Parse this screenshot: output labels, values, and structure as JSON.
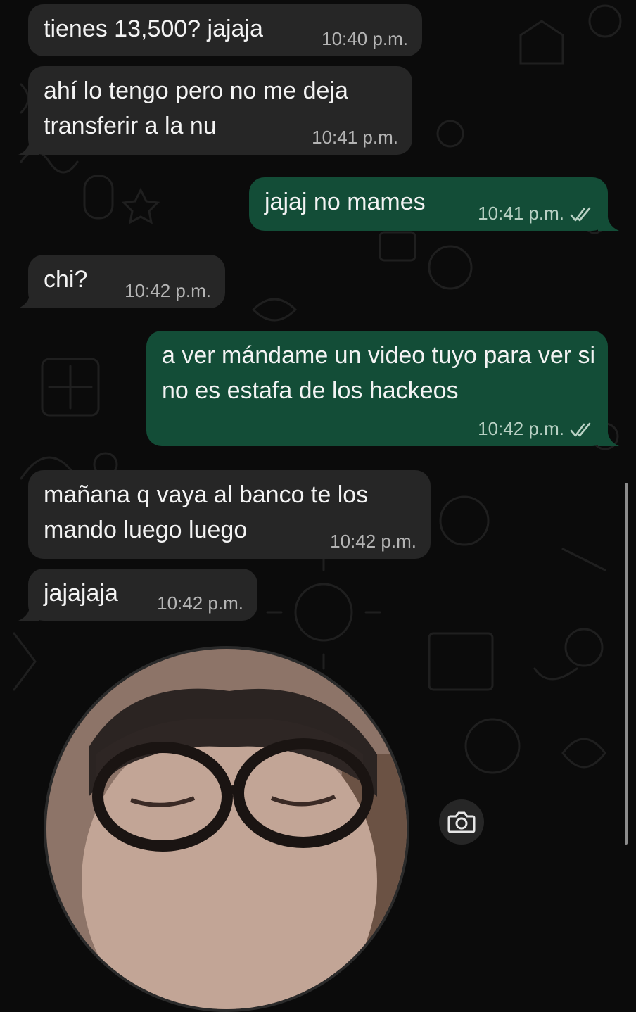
{
  "colors": {
    "background": "#0b0b0b",
    "incoming_bubble": "#262626",
    "outgoing_bubble": "#134d37",
    "text": "#f3f3f3",
    "read_ticks": "#b9d1c4"
  },
  "messages": [
    {
      "direction": "incoming",
      "text": "tienes 13,500? jajaja",
      "time": "10:40 p.m."
    },
    {
      "direction": "incoming",
      "text": "ahí lo tengo pero no me deja transferir a la nu",
      "time": "10:41 p.m."
    },
    {
      "direction": "outgoing",
      "text": "jajaj no mames",
      "time": "10:41 p.m.",
      "status": "read"
    },
    {
      "direction": "incoming",
      "text": "chi?",
      "time": "10:42 p.m."
    },
    {
      "direction": "outgoing",
      "text": "a ver mándame un video tuyo para ver si no es estafa de los hackeos",
      "time": "10:42 p.m.",
      "status": "read"
    },
    {
      "direction": "incoming",
      "text": "mañana q vaya al banco te los mando luego luego",
      "time": "10:42 p.m."
    },
    {
      "direction": "incoming",
      "text": "jajajaja",
      "time": "10:42 p.m."
    }
  ],
  "video_note": {
    "icon": "camera-icon"
  }
}
